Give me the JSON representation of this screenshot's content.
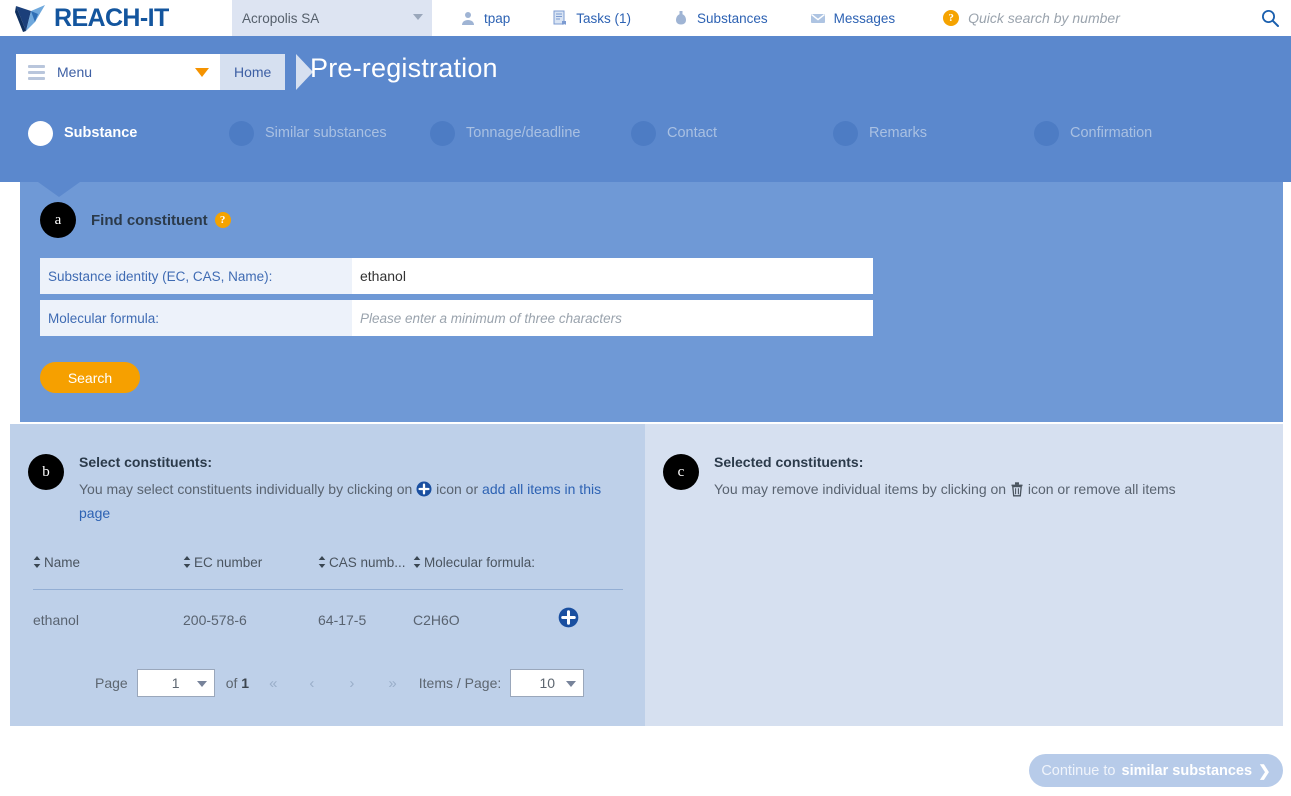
{
  "brand": {
    "name": "REACH-IT",
    "logo_icon": "reachit-logo-icon"
  },
  "topbar": {
    "org": {
      "value": "Acropolis SA",
      "caret_icon": "chevron-down-icon"
    },
    "nav": [
      {
        "label": "tpap",
        "icon": "user-icon"
      },
      {
        "label": "Tasks (1)",
        "icon": "tasks-document-icon"
      },
      {
        "label": "Substances",
        "icon": "flask-icon"
      },
      {
        "label": "Messages",
        "icon": "envelope-icon"
      }
    ],
    "quick_search": {
      "help_icon": "question-mark-icon",
      "placeholder": "Quick search by number",
      "value": "",
      "search_icon": "magnifier-icon"
    }
  },
  "header": {
    "menu": {
      "label": "Menu",
      "burger_icon": "hamburger-icon",
      "caret_icon": "chevron-down-icon"
    },
    "breadcrumb_home": "Home",
    "title": "Pre-registration"
  },
  "steps": [
    {
      "label": "Substance",
      "active": true
    },
    {
      "label": "Similar substances",
      "active": false
    },
    {
      "label": "Tonnage/deadline",
      "active": false
    },
    {
      "label": "Contact",
      "active": false
    },
    {
      "label": "Remarks",
      "active": false
    },
    {
      "label": "Confirmation",
      "active": false
    }
  ],
  "section_a": {
    "badge": "a",
    "title": "Find constituent",
    "help_icon": "question-mark-icon",
    "fields": [
      {
        "label": "Substance identity (EC, CAS, Name):",
        "value": "ethanol",
        "placeholder": ""
      },
      {
        "label": "Molecular formula:",
        "value": "",
        "placeholder": "Please enter a minimum of three characters"
      }
    ],
    "search_button": "Search"
  },
  "section_b": {
    "badge": "b",
    "title": "Select constituents:",
    "desc_before": "You may select constituents individually by clicking on",
    "plus_icon": "plus-circle-icon",
    "desc_mid": "icon or",
    "link": "add all items in this page",
    "table": {
      "columns": [
        "Name",
        "EC number",
        "CAS numb...",
        "Molecular formula:"
      ],
      "sort_icon": "sort-updown-icon",
      "rows": [
        {
          "name": "ethanol",
          "ec": "200-578-6",
          "cas": "64-17-5",
          "formula": "C2H6O",
          "add_icon": "plus-circle-icon"
        }
      ]
    },
    "pager": {
      "page_label": "Page",
      "page_value": "1",
      "of_label": "of",
      "total_pages": "1",
      "first_icon": "«",
      "prev_icon": "‹",
      "next_icon": "›",
      "last_icon": "»",
      "items_label": "Items / Page:",
      "items_value": "10"
    }
  },
  "section_c": {
    "badge": "c",
    "title": "Selected constituents:",
    "desc_before": "You may remove individual items by clicking on",
    "trash_icon": "trash-icon",
    "desc_after": "icon or remove all items"
  },
  "footer": {
    "continue_prefix": "Continue to ",
    "continue_target": "similar substances",
    "chevron_icon": "chevron-right-icon"
  },
  "colors": {
    "brand_blue": "#13559e",
    "header_blue": "#5b88cd",
    "panel_a": "#6f99d6",
    "panel_b": "#bed0e9",
    "panel_c": "#d6e0f0",
    "accent_orange": "#f6a000",
    "link_blue": "#2d62b3"
  }
}
